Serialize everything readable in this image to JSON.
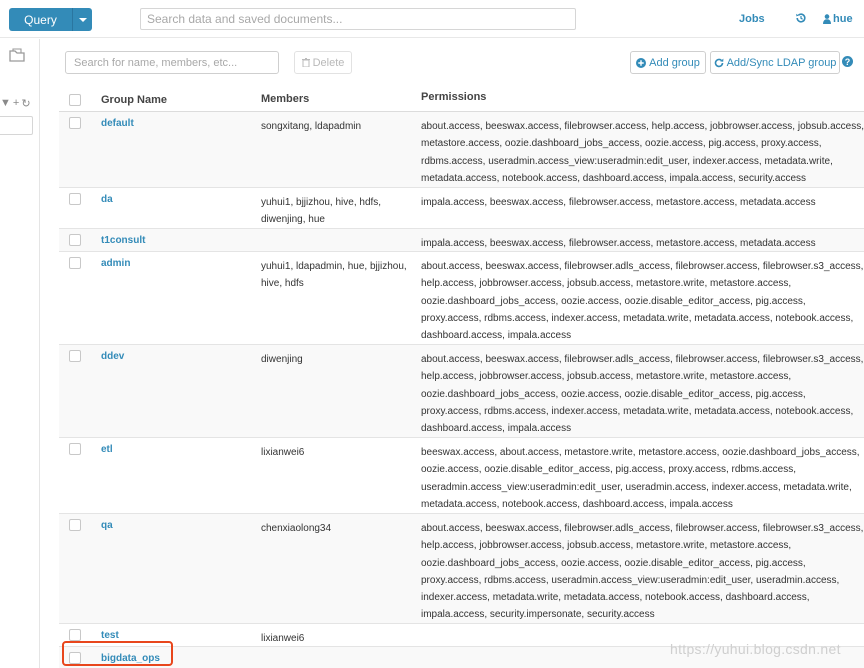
{
  "topbar": {
    "query_label": "Query",
    "search_placeholder": "Search data and saved documents...",
    "jobs_label": "Jobs",
    "user_label": "hue"
  },
  "toolbar": {
    "filter_placeholder": "Search for name, members, etc...",
    "delete_label": "Delete",
    "add_group_label": "Add group",
    "sync_label": "Add/Sync LDAP group"
  },
  "table": {
    "headers": {
      "name": "Group Name",
      "members": "Members",
      "permissions": "Permissions"
    },
    "rows": [
      {
        "name": "default",
        "members": "songxitang, ldapadmin",
        "permissions": "about.access, beeswax.access, filebrowser.access, help.access, jobbrowser.access, jobsub.access, metastore.access, oozie.dashboard_jobs_access, oozie.access, pig.access, proxy.access, rdbms.access, useradmin.access_view:useradmin:edit_user, indexer.access, metadata.write, metadata.access, notebook.access, dashboard.access, impala.access, security.access"
      },
      {
        "name": "da",
        "members": "yuhui1, bjjizhou, hive, hdfs, diwenjing, hue",
        "permissions": "impala.access, beeswax.access, filebrowser.access, metastore.access, metadata.access"
      },
      {
        "name": "t1consult",
        "members": "",
        "permissions": "impala.access, beeswax.access, filebrowser.access, metastore.access, metadata.access"
      },
      {
        "name": "admin",
        "members": "yuhui1, ldapadmin, hue, bjjizhou, hive, hdfs",
        "permissions": "about.access, beeswax.access, filebrowser.adls_access, filebrowser.access, filebrowser.s3_access, help.access, jobbrowser.access, jobsub.access, metastore.write, metastore.access, oozie.dashboard_jobs_access, oozie.access, oozie.disable_editor_access, pig.access, proxy.access, rdbms.access, indexer.access, metadata.write, metadata.access, notebook.access, dashboard.access, impala.access"
      },
      {
        "name": "ddev",
        "members": "diwenjing",
        "permissions": "about.access, beeswax.access, filebrowser.adls_access, filebrowser.access, filebrowser.s3_access, help.access, jobbrowser.access, jobsub.access, metastore.write, metastore.access, oozie.dashboard_jobs_access, oozie.access, oozie.disable_editor_access, pig.access, proxy.access, rdbms.access, indexer.access, metadata.write, metadata.access, notebook.access, dashboard.access, impala.access"
      },
      {
        "name": "etl",
        "members": "lixianwei6",
        "permissions": "beeswax.access, about.access, metastore.write, metastore.access, oozie.dashboard_jobs_access, oozie.access, oozie.disable_editor_access, pig.access, proxy.access, rdbms.access, useradmin.access_view:useradmin:edit_user, useradmin.access, indexer.access, metadata.write, metadata.access, notebook.access, dashboard.access, impala.access"
      },
      {
        "name": "qa",
        "members": "chenxiaolong34",
        "permissions": "about.access, beeswax.access, filebrowser.adls_access, filebrowser.access, filebrowser.s3_access, help.access, jobbrowser.access, jobsub.access, metastore.write, metastore.access, oozie.dashboard_jobs_access, oozie.access, oozie.disable_editor_access, pig.access, proxy.access, rdbms.access, useradmin.access_view:useradmin:edit_user, useradmin.access, indexer.access, metadata.write, metadata.access, notebook.access, dashboard.access, impala.access, security.impersonate, security.access"
      },
      {
        "name": "test",
        "members": "lixianwei6",
        "permissions": ""
      },
      {
        "name": "bigdata_ops",
        "members": "",
        "permissions": ""
      }
    ]
  },
  "watermark": "https://yuhui.blog.csdn.net",
  "colors": {
    "accent": "#338bb8",
    "highlight": "#e8461c"
  }
}
